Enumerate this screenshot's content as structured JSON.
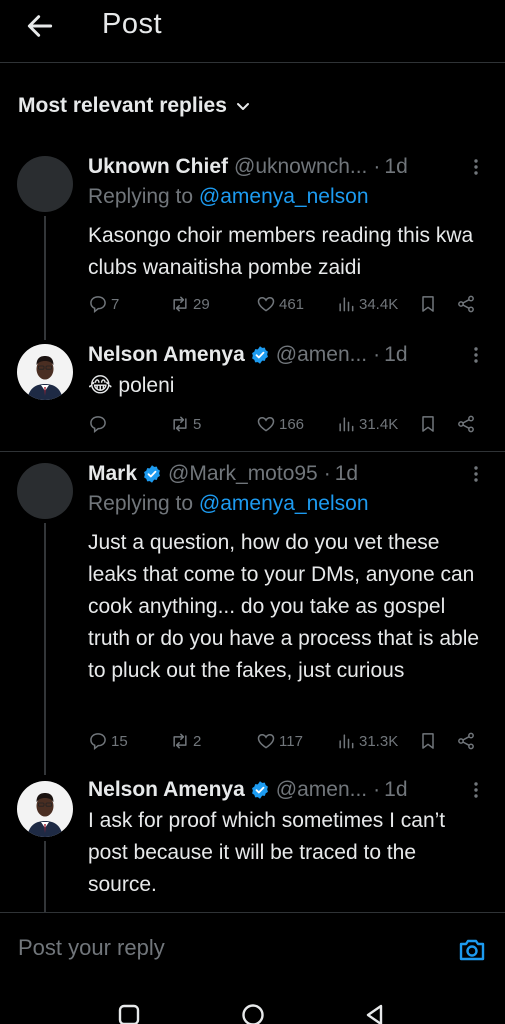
{
  "header": {
    "title": "Post"
  },
  "sort": {
    "label": "Most relevant replies"
  },
  "posts": [
    {
      "name": "Uknown Chief",
      "handle": "@uknownch...",
      "dot": "·",
      "time": "1d",
      "verified": false,
      "replying_prefix": "Replying to ",
      "replying_to": "@amenya_nelson",
      "text": "Kasongo choir members reading this kwa clubs wanaitisha pombe zaidi",
      "replies": "7",
      "reposts": "29",
      "likes": "461",
      "views": "34.4K"
    },
    {
      "name": "Nelson Amenya",
      "handle": "@amen...",
      "dot": "·",
      "time": "1d",
      "verified": true,
      "emoji": "😂",
      "text": "poleni",
      "replies": "",
      "reposts": "5",
      "likes": "166",
      "views": "31.4K"
    },
    {
      "name": "Mark",
      "handle": "@Mark_moto95",
      "dot": "·",
      "time": "1d",
      "verified": true,
      "replying_prefix": "Replying to ",
      "replying_to": "@amenya_nelson",
      "text": "Just a question, how do you vet these leaks that come to your DMs, anyone can cook anything... do you take as gospel truth or do you have a process that is able to pluck out the fakes, just curious",
      "replies": "15",
      "reposts": "2",
      "likes": "117",
      "views": "31.3K"
    },
    {
      "name": "Nelson Amenya",
      "handle": "@amen...",
      "dot": "·",
      "time": "1d",
      "verified": true,
      "text": "I ask for proof which sometimes I can’t post because it will be traced to the source."
    }
  ],
  "composer": {
    "placeholder": "Post your reply"
  },
  "icons": {
    "back": "arrow-left-icon",
    "chevron": "chevron-down-icon",
    "more": "more-vertical-icon",
    "reply": "comment-icon",
    "repost": "repost-icon",
    "like": "heart-icon",
    "views": "views-icon",
    "bookmark": "bookmark-icon",
    "share": "share-icon",
    "camera": "camera-icon"
  },
  "colors": {
    "accent": "#1d9bf0",
    "muted": "#71767b",
    "text": "#e7e9ea",
    "background": "#000000"
  }
}
